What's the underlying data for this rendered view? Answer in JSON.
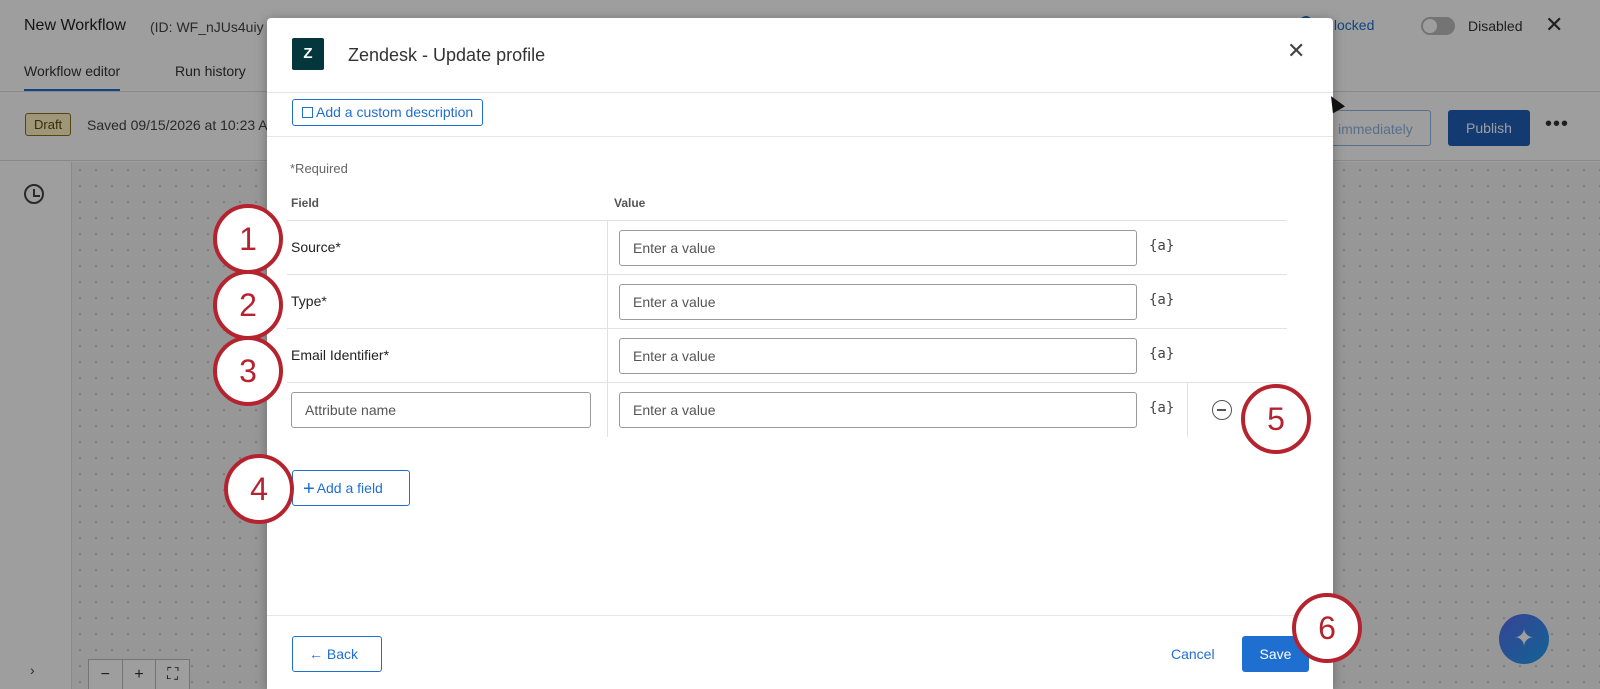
{
  "app": {
    "title": "New Workflow",
    "id_label": "(ID: WF_nJUs4uiy",
    "tabs": [
      "Workflow editor",
      "Run history"
    ],
    "lock_status": "Unlocked",
    "toggle_label": "Disabled",
    "draft_badge": "Draft",
    "saved_text": "Saved 09/15/2026 at 10:23 A",
    "run_button": "immediately",
    "publish_button": "Publish"
  },
  "modal": {
    "title": "Zendesk - Update profile",
    "logo_text": "Z",
    "description_button": "Add a custom description",
    "required_note": "*Required",
    "columns": {
      "field": "Field",
      "value": "Value"
    },
    "rows": [
      {
        "label": "Source*",
        "placeholder": "Enter a value"
      },
      {
        "label": "Type*",
        "placeholder": "Enter a value"
      },
      {
        "label": "Email Identifier*",
        "placeholder": "Enter a value"
      }
    ],
    "custom_row": {
      "attr_placeholder": "Attribute name",
      "value_placeholder": "Enter a value"
    },
    "piped_text_icon": "{a}",
    "add_field_button": "Add a field",
    "back_button": "Back",
    "cancel_button": "Cancel",
    "save_button": "Save"
  },
  "callouts": [
    "1",
    "2",
    "3",
    "4",
    "5",
    "6"
  ],
  "colors": {
    "accent": "#1f6fd0",
    "callout": "#b5232f",
    "zendesk": "#03363d"
  }
}
